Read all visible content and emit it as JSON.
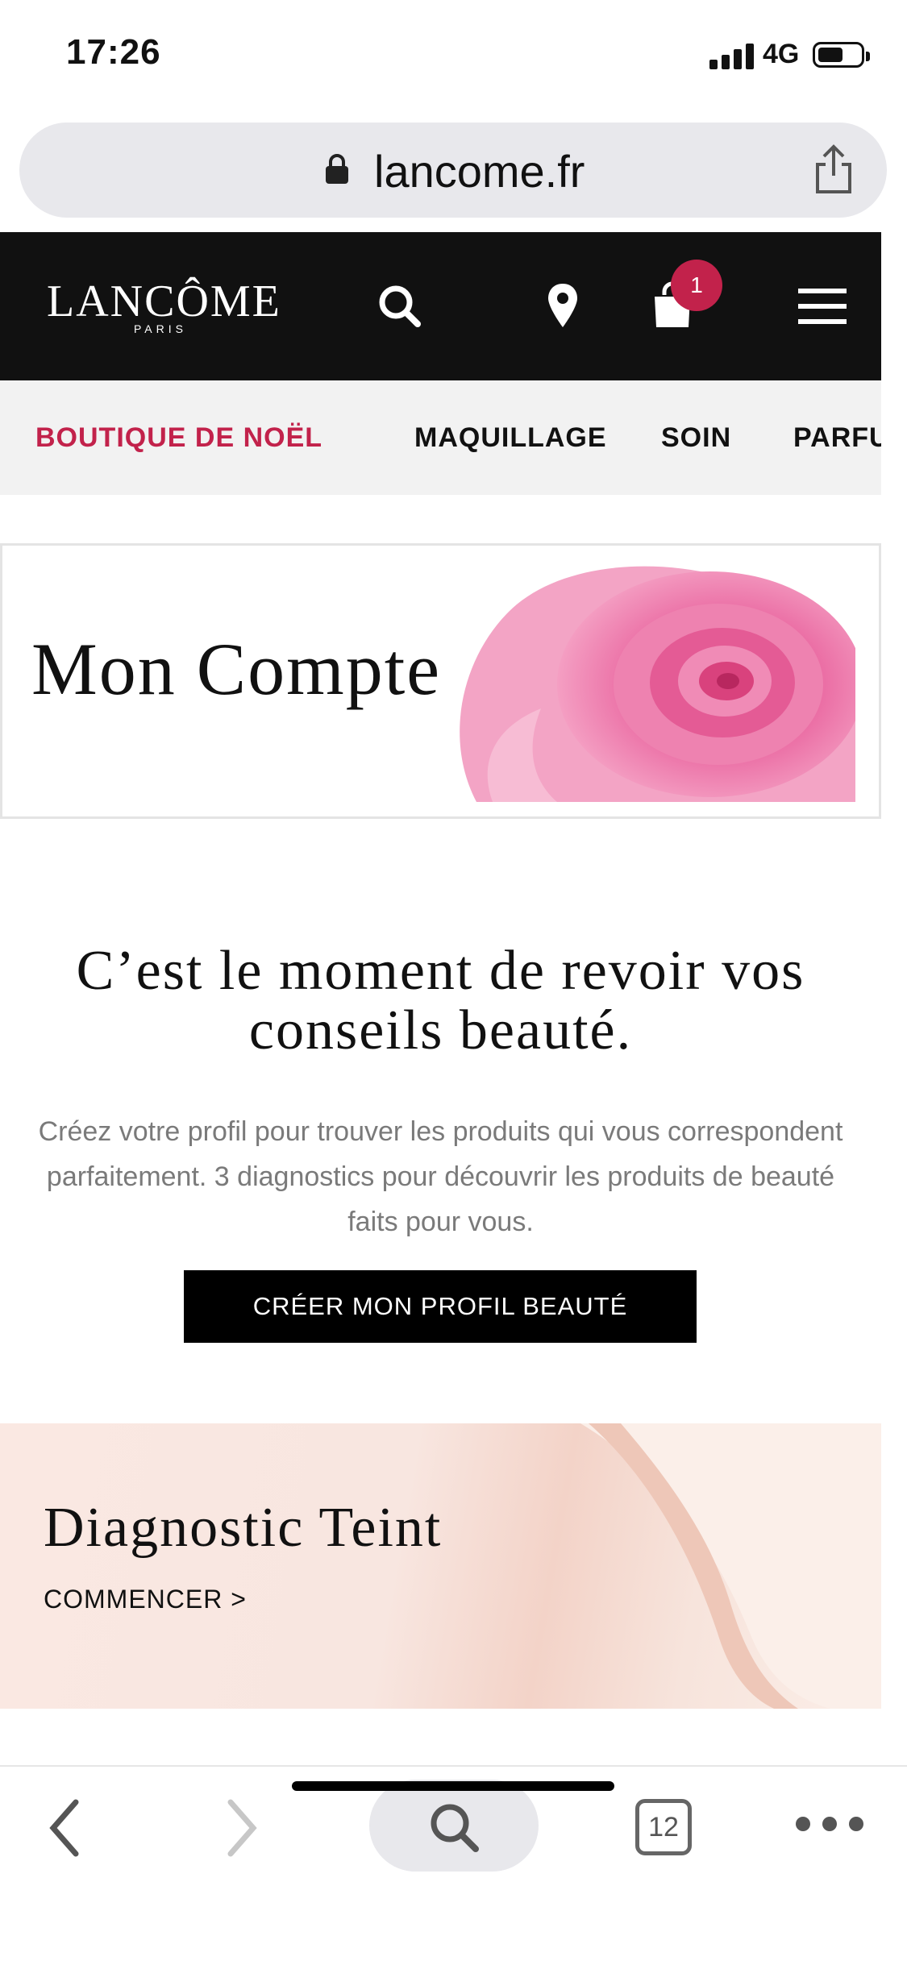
{
  "status": {
    "time": "17:26",
    "network": "4G"
  },
  "browser": {
    "url": "lancome.fr",
    "tab_count": "12"
  },
  "header": {
    "logo": "LANCÔME",
    "logo_sub": "PARIS",
    "cart_count": "1"
  },
  "nav": {
    "items": [
      "BOUTIQUE DE NOËL",
      "MAQUILLAGE",
      "SOIN",
      "PARFU"
    ]
  },
  "banner": {
    "title": "Mon Compte"
  },
  "section": {
    "headline_line1": "C’est le moment de revoir vos",
    "headline_line2": "conseils beauté.",
    "sub_line1": "Créez votre profil pour trouver les produits qui vous correspondent",
    "sub_line2": "parfaitement. 3 diagnostics pour découvrir les produits de beauté",
    "sub_line3": "faits pour vous.",
    "cta": "CRÉER MON PROFIL BEAUTÉ"
  },
  "diagnostic": {
    "title": "Diagnostic Teint",
    "link": "COMMENCER >"
  },
  "colors": {
    "accent": "#c2224b",
    "header_bg": "#111111",
    "nav_bg": "#f2f2f2"
  }
}
